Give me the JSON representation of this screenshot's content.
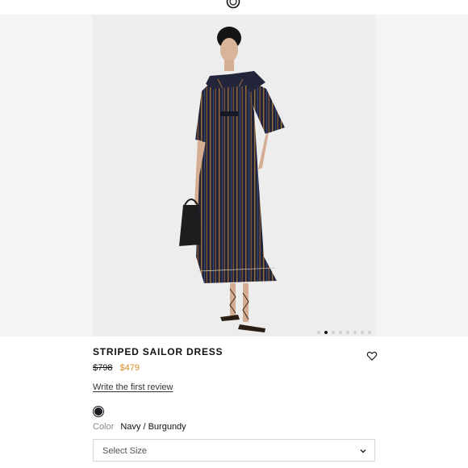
{
  "product": {
    "title": "STRIPED SAILOR DRESS",
    "price_original": "$798",
    "price_sale": "$479",
    "review_link": "Write the first review",
    "color_label": "Color",
    "color_value": "Navy / Burgundy",
    "size_placeholder": "Select Size"
  },
  "gallery": {
    "image_count": 8,
    "active_index": 1
  },
  "colors": {
    "sale_price": "#d58d1f",
    "swatch": "#1b1b1f",
    "dress_navy": "#22243a",
    "stripe_tan": "#9a6d3b"
  },
  "icons": {
    "brand": "brand-logo-icon",
    "wishlist": "heart-icon",
    "dropdown": "chevron-down-icon"
  }
}
